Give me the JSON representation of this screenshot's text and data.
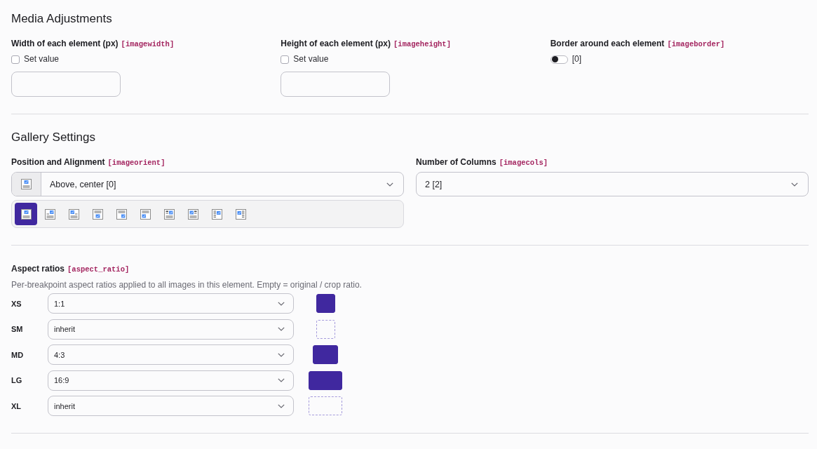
{
  "media_adjustments": {
    "title": "Media Adjustments",
    "fields": [
      {
        "kind": "number",
        "label": "Width of each element (px)",
        "param": "[imagewidth]",
        "set_value": {
          "label": "Set value",
          "checked": false
        }
      },
      {
        "kind": "number",
        "label": "Height of each element (px)",
        "param": "[imageheight]",
        "set_value": {
          "label": "Set value",
          "checked": false
        }
      },
      {
        "kind": "toggle",
        "label": "Border around each element",
        "param": "[imageborder]",
        "on": false,
        "value": "[0]"
      }
    ]
  },
  "gallery_settings": {
    "title": "Gallery Settings",
    "position": {
      "label": "Position and Alignment",
      "param": "[imageorient]",
      "value": "Above, center [0]",
      "options": [
        {
          "kind": "above-center",
          "selected": true
        },
        {
          "kind": "above-right",
          "selected": false
        },
        {
          "kind": "above-left",
          "selected": false
        },
        {
          "kind": "below-center",
          "selected": false
        },
        {
          "kind": "below-right",
          "selected": false
        },
        {
          "kind": "below-left",
          "selected": false
        },
        {
          "kind": "wrap-right",
          "selected": false
        },
        {
          "kind": "wrap-left",
          "selected": false
        },
        {
          "kind": "beside-right",
          "selected": false
        },
        {
          "kind": "beside-left",
          "selected": false
        }
      ]
    },
    "columns": {
      "label": "Number of Columns",
      "param": "[imagecols]",
      "value": "2 [2]"
    }
  },
  "aspect_ratios": {
    "label": "Aspect ratios",
    "param": "[aspect_ratio]",
    "description": "Per-breakpoint aspect ratios applied to all images in this element. Empty = original / crop ratio.",
    "rows": [
      {
        "breakpoint": "XS",
        "value": "1:1",
        "inherited": false
      },
      {
        "breakpoint": "SM",
        "value": "inherit",
        "inherited": true
      },
      {
        "breakpoint": "MD",
        "value": "4:3",
        "inherited": false
      },
      {
        "breakpoint": "LG",
        "value": "16:9",
        "inherited": false
      },
      {
        "breakpoint": "XL",
        "value": "inherit",
        "inherited": true
      }
    ]
  }
}
